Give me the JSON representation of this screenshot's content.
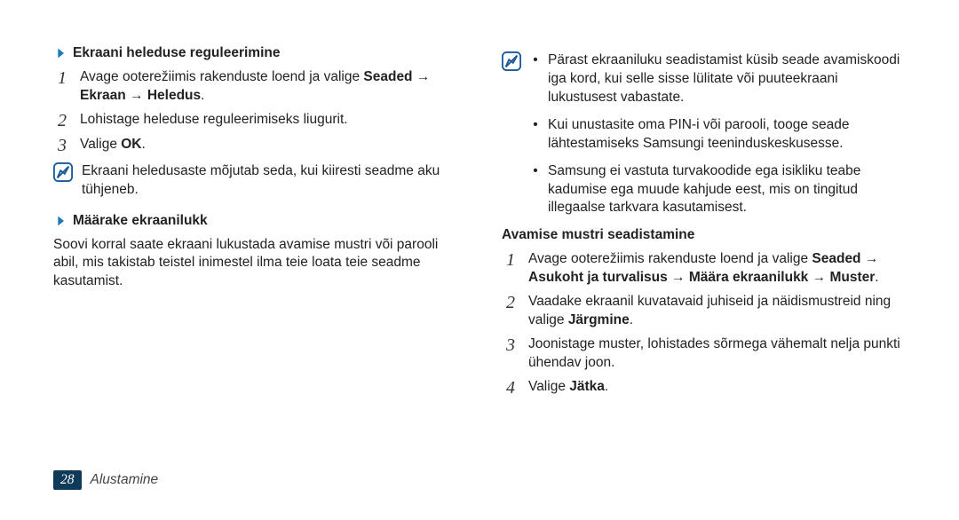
{
  "colors": {
    "badge_bg": "#0f3a59"
  },
  "left": {
    "heading1": "Ekraani heleduse reguleerimine",
    "s1": "Avage ooterežiimis rakenduste loend ja valige ",
    "s1_b1": "Seaded",
    "s1_mid1": " → ",
    "s1_b2": "Ekraan",
    "s1_mid2": " → ",
    "s1_b3": "Heledus",
    "s1_end": ".",
    "s2": "Lohistage heleduse reguleerimiseks liugurit.",
    "s3_a": "Valige ",
    "s3_b": "OK",
    "s3_c": ".",
    "note1": "Ekraani heledusaste mõjutab seda, kui kiiresti seadme aku tühjeneb.",
    "heading2": "Määrake ekraanilukk",
    "para2": "Soovi korral saate ekraani lukustada avamise mustri või parooli abil, mis takistab teistel inimestel ilma teie loata teie seadme kasutamist."
  },
  "right": {
    "note_bullets": {
      "b1": "Pärast ekraaniluku seadistamist küsib seade avamiskoodi iga kord, kui selle sisse lülitate või puuteekraani lukustusest vabastate.",
      "b2": "Kui unustasite oma PIN-i või parooli, tooge seade lähtestamiseks Samsungi teeninduskeskusesse.",
      "b3": "Samsung ei vastuta turvakoodide ega isikliku teabe kadumise ega muude kahjude eest, mis on tingitud illegaalse tarkvara kasutamisest."
    },
    "subheading": "Avamise mustri seadistamine",
    "s1": "Avage ooterežiimis rakenduste loend ja valige ",
    "s1_b1": "Seaded",
    "s1_m1": " → ",
    "s1_b2": "Asukoht ja turvalisus",
    "s1_m2": " → ",
    "s1_b3": "Määra ekraanilukk",
    "s1_m3": " → ",
    "s1_b4": "Muster",
    "s1_end": ".",
    "s2_a": "Vaadake ekraanil kuvatavaid juhiseid ja näidismustreid ning valige ",
    "s2_b": "Järgmine",
    "s2_c": ".",
    "s3": "Joonistage muster, lohistades sõrmega vähemalt nelja punkti ühendav joon.",
    "s4_a": "Valige ",
    "s4_b": "Jätka",
    "s4_c": "."
  },
  "footer": {
    "page": "28",
    "section": "Alustamine"
  },
  "numerals": {
    "n1": "1",
    "n2": "2",
    "n3": "3",
    "n4": "4"
  },
  "bullet_mark": "•"
}
